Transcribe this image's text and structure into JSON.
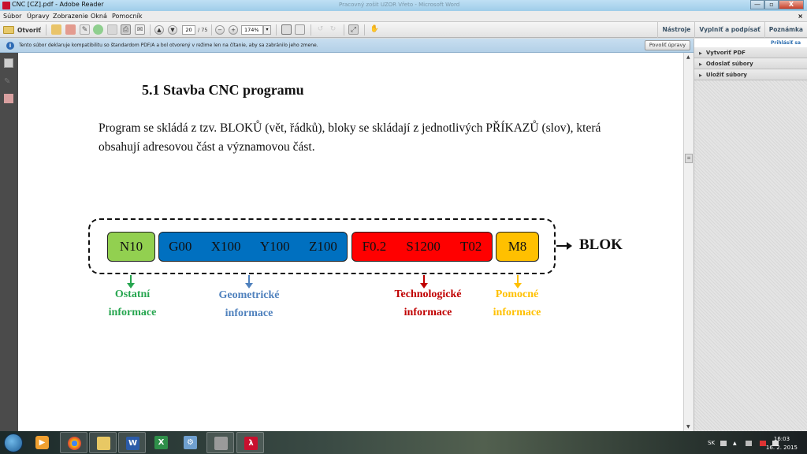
{
  "window": {
    "title": "CNC [CZ].pdf - Adobe Reader",
    "background_title": "Pracovný zošit UZOR Vřeto - Microsoft Word",
    "controls": {
      "minimize": "—",
      "maximize": "▫",
      "close": "X"
    }
  },
  "menu": {
    "items": [
      "Súbor",
      "Úpravy",
      "Zobrazenie",
      "Okná",
      "Pomocník"
    ],
    "close_glyph": "×"
  },
  "toolbar": {
    "open_label": "Otvoriť",
    "page_current": "20",
    "page_total": "/ 75",
    "zoom_value": "174%",
    "zoom_dropdown": "▾",
    "right_links": [
      "Nástroje",
      "Vyplniť a podpísať",
      "Poznámka"
    ]
  },
  "infobar": {
    "message": "Tento súbor deklaruje kompatibilitu so štandardom PDF/A a bol otvorený v režime len na čítanie, aby sa zabránilo jeho zmene.",
    "button_label": "Povoliť úpravy"
  },
  "right_panel": {
    "signin": "Prihlásiť sa",
    "items": [
      "Vytvoriť PDF",
      "Odoslať súbory",
      "Uložiť súbory"
    ]
  },
  "document": {
    "heading": "5.1 Stavba CNC programu",
    "paragraph": "Program se skládá z tzv. BLOKŮ (vět, řádků), bloky se skládají z jednotlivých PŘÍKAZŮ (slov), která obsahují adresovou část a významovou část.",
    "diagram": {
      "groups": [
        {
          "words": [
            "N10"
          ],
          "color": "#92d050",
          "label_lines": [
            "Ostatní",
            "informace"
          ],
          "label_color": "#27a650"
        },
        {
          "words": [
            "G00",
            "X100",
            "Y100",
            "Z100"
          ],
          "color": "#0070c0",
          "label_lines": [
            "Geometrické",
            "informace"
          ],
          "label_color": "#4f81bd"
        },
        {
          "words": [
            "F0.2",
            "S1200",
            "T02"
          ],
          "color": "#ff0000",
          "label_lines": [
            "Technologické",
            "informace"
          ],
          "label_color": "#c00000"
        },
        {
          "words": [
            "M8"
          ],
          "color": "#ffc000",
          "label_lines": [
            "Pomocné",
            "informace"
          ],
          "label_color": "#ffc000"
        }
      ],
      "block_label": "BLOK"
    }
  },
  "taskbar": {
    "apps": [
      "Windows Media Player",
      "Google Chrome",
      "Windows Explorer",
      "Microsoft Word",
      "Microsoft Excel",
      "Control Panel",
      "Application",
      "Adobe Reader"
    ],
    "language": "SK",
    "time": "16:03",
    "date": "16. 2. 2015"
  }
}
